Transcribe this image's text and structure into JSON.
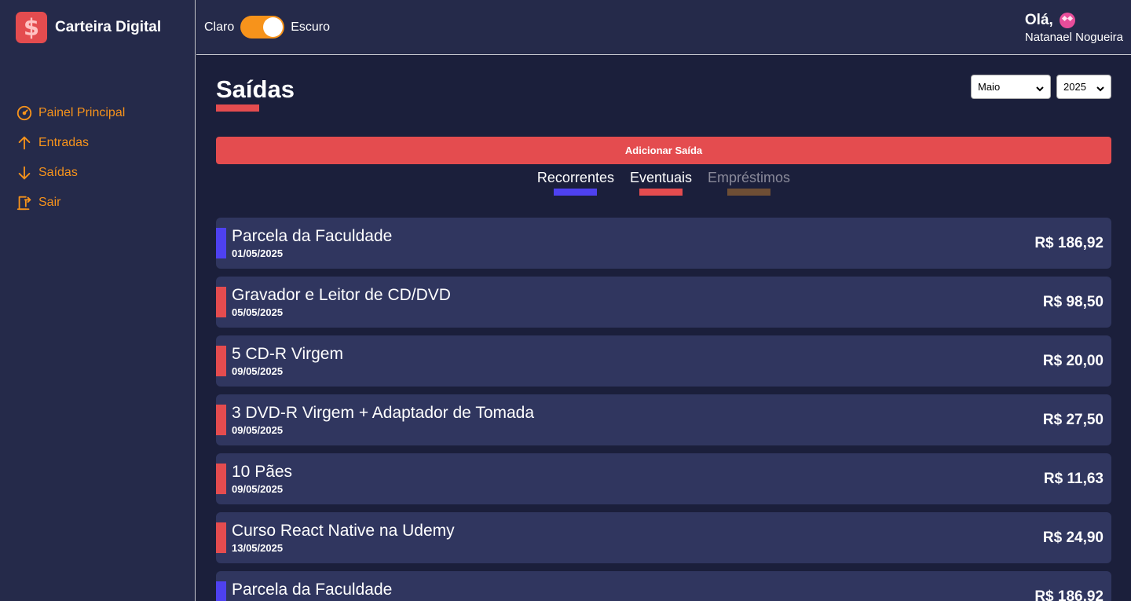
{
  "brand": {
    "logo_symbol": "$",
    "name": "Carteira Digital"
  },
  "sidebar": {
    "items": [
      {
        "label": "Painel Principal",
        "icon": "dashboard-icon"
      },
      {
        "label": "Entradas",
        "icon": "arrow-up-icon"
      },
      {
        "label": "Saídas",
        "icon": "arrow-down-icon"
      },
      {
        "label": "Sair",
        "icon": "exit-icon"
      }
    ]
  },
  "header": {
    "theme_light_label": "Claro",
    "theme_dark_label": "Escuro",
    "theme_dark_enabled": true,
    "greeting": "Olá,",
    "user_name": "Natanael Nogueira"
  },
  "page": {
    "title": "Saídas",
    "month_select": {
      "value": "Maio"
    },
    "year_select": {
      "value": "2025"
    },
    "add_button": "Adicionar Saída",
    "filters": [
      {
        "label": "Recorrentes",
        "color": "#4e41f0"
      },
      {
        "label": "Eventuais",
        "color": "#e44c4f"
      },
      {
        "label": "Empréstimos",
        "color": "#6e4e35"
      }
    ]
  },
  "entries": [
    {
      "description": "Parcela da Faculdade",
      "date": "01/05/2025",
      "amount": "R$ 186,92",
      "type": "recorrente"
    },
    {
      "description": "Gravador e Leitor de CD/DVD",
      "date": "05/05/2025",
      "amount": "R$ 98,50",
      "type": "eventual"
    },
    {
      "description": "5 CD-R Virgem",
      "date": "09/05/2025",
      "amount": "R$ 20,00",
      "type": "eventual"
    },
    {
      "description": "3 DVD-R Virgem + Adaptador de Tomada",
      "date": "09/05/2025",
      "amount": "R$ 27,50",
      "type": "eventual"
    },
    {
      "description": "10 Pães",
      "date": "09/05/2025",
      "amount": "R$ 11,63",
      "type": "eventual"
    },
    {
      "description": "Curso React Native na Udemy",
      "date": "13/05/2025",
      "amount": "R$ 24,90",
      "type": "eventual"
    },
    {
      "description": "Parcela da Faculdade",
      "date": "",
      "amount": "R$ 186,92",
      "type": "recorrente"
    }
  ],
  "colors": {
    "accent_orange": "#f7931b",
    "accent_red": "#e44c4f",
    "accent_blue": "#4e41f0",
    "background": "#1b1f3b",
    "panel": "#252a4a",
    "card": "#30365f"
  }
}
